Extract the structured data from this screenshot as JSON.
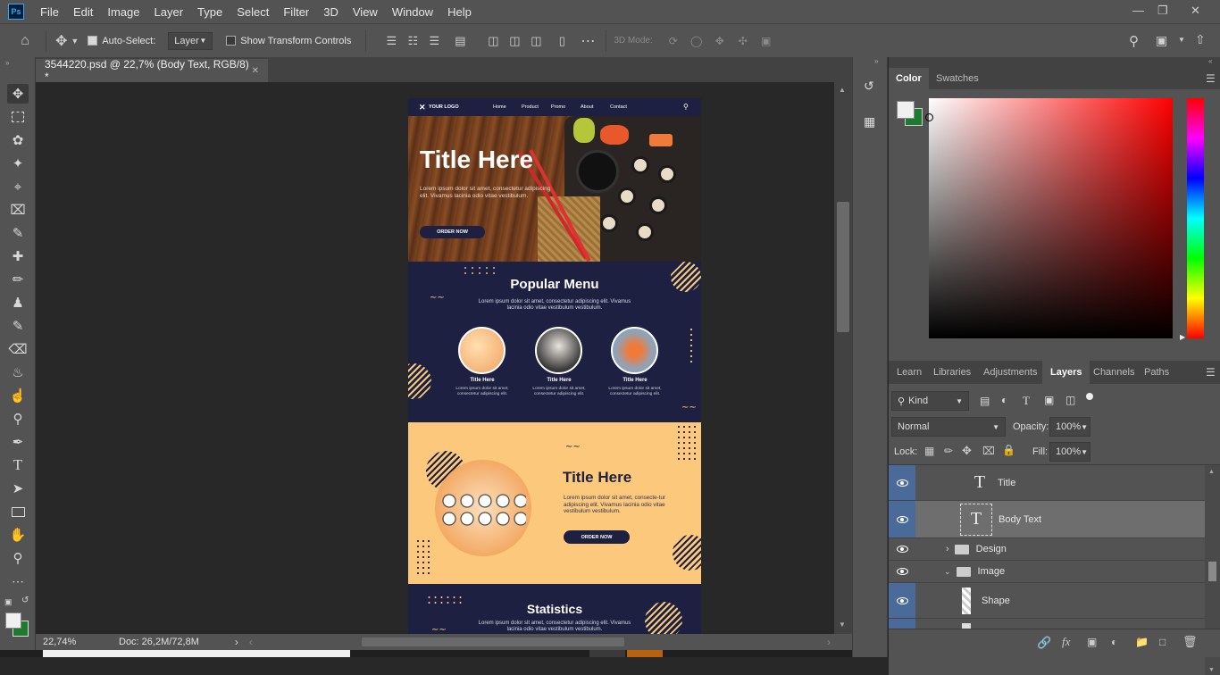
{
  "menu": [
    "File",
    "Edit",
    "Image",
    "Layer",
    "Type",
    "Select",
    "Filter",
    "3D",
    "View",
    "Window",
    "Help"
  ],
  "options": {
    "auto_select_label": "Auto-Select:",
    "auto_select_value": "Layer",
    "show_transform_label": "Show Transform Controls",
    "mode_3d_label": "3D Mode:"
  },
  "document": {
    "tab_title": "3544220.psd @ 22,7% (Body Text, RGB/8) *",
    "zoom": "22,74%",
    "doc_size": "Doc: 26,2M/72,8M"
  },
  "canvas": {
    "logo": "YOUR LOGO",
    "nav": [
      "Home",
      "Product",
      "Promo",
      "About",
      "Contact"
    ],
    "hero_title": "Title Here",
    "hero_body": "Lorem ipsum dolor sit amet, consectetur adipiscing elit. Vivamus lacinia odio vitae vestibulum.",
    "hero_button": "ORDER NOW",
    "menu_title": "Popular Menu",
    "menu_body": "Lorem ipsum dolor sit amet, consectetur adipiscing elit. Vivamus lacinia odio vitae vestibulum vestibulum.",
    "items": [
      {
        "title": "Title Here",
        "body": "Lorem ipsum dolor sit amet, consectetur adipiscing elit."
      },
      {
        "title": "Title Here",
        "body": "Lorem ipsum dolor sit amet, consectetur adipiscing elit."
      },
      {
        "title": "Title Here",
        "body": "Lorem ipsum dolor sit amet, consectetur adipiscing elit."
      }
    ],
    "promo_title": "Title Here",
    "promo_body": "Lorem ipsum dolor sit amet, consecte-tur adipiscing elit. Vivamus lacinia odio vitae vestibulum vestibulum.",
    "promo_button": "ORDER NOW",
    "stats_title": "Statistics",
    "stats_body": "Lorem ipsum dolor sit amet, consectetur adipiscing elit. Vivamus lacinia odio vitae vestibulum vestibulum."
  },
  "color_panel": {
    "tabs": [
      "Color",
      "Swatches"
    ],
    "foreground": "#f0f0f0",
    "background": "#1e7a2e",
    "hue_color": "#ff0000"
  },
  "layers_panel": {
    "tabs": [
      "Learn",
      "Libraries",
      "Adjustments",
      "Layers",
      "Channels",
      "Paths"
    ],
    "filter_kind": "Kind",
    "blend_mode": "Normal",
    "opacity_label": "Opacity:",
    "opacity": "100%",
    "lock_label": "Lock:",
    "fill_label": "Fill:",
    "fill": "100%",
    "layers": [
      {
        "name": "Title",
        "type": "text",
        "selected": false
      },
      {
        "name": "Body Text",
        "type": "text",
        "selected": true
      },
      {
        "name": "Design",
        "type": "group",
        "expanded": false
      },
      {
        "name": "Image",
        "type": "group",
        "expanded": true
      },
      {
        "name": "Shape",
        "type": "shape",
        "selected": false
      }
    ]
  }
}
